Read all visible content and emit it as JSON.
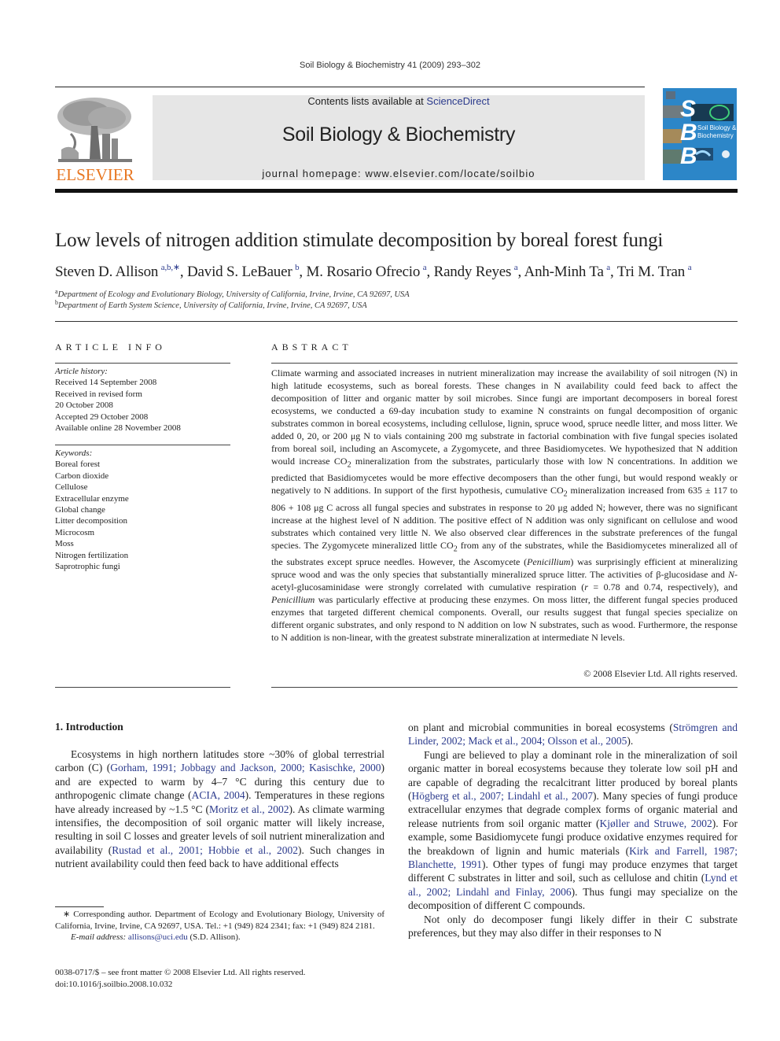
{
  "running_head": "Soil Biology & Biochemistry 41 (2009) 293–302",
  "publisher": {
    "name": "ELSEVIER",
    "color": "#e87722"
  },
  "banner": {
    "contents_prefix": "Contents lists available at ",
    "contents_link": "ScienceDirect",
    "journal_title": "Soil Biology & Biochemistry",
    "homepage": "journal homepage: www.elsevier.com/locate/soilbio"
  },
  "cover": {
    "letters": [
      "S",
      "B",
      "B"
    ],
    "caption_line1": "Soil Biology &",
    "caption_line2": "Biochemistry",
    "bg_color": "#2c86c8"
  },
  "article": {
    "title": "Low levels of nitrogen addition stimulate decomposition by boreal forest fungi",
    "authors": [
      {
        "name": "Steven D. Allison",
        "sup": "a,b,∗",
        "sep": ", "
      },
      {
        "name": "David S. LeBauer",
        "sup": "b",
        "sep": ", "
      },
      {
        "name": "M. Rosario Ofrecio",
        "sup": "a",
        "sep": ", "
      },
      {
        "name": "Randy Reyes",
        "sup": "a",
        "sep": ", "
      },
      {
        "name": "Anh-Minh Ta",
        "sup": "a",
        "sep": ", "
      },
      {
        "name": "Tri M. Tran",
        "sup": "a",
        "sep": ""
      }
    ],
    "affiliations": [
      {
        "mark": "a",
        "text": "Department of Ecology and Evolutionary Biology, University of California, Irvine, Irvine, CA 92697, USA"
      },
      {
        "mark": "b",
        "text": "Department of Earth System Science, University of California, Irvine, Irvine, CA 92697, USA"
      }
    ]
  },
  "article_info": {
    "heading": "ARTICLE INFO",
    "history_label": "Article history:",
    "history": [
      "Received 14 September 2008",
      "Received in revised form",
      "20 October 2008",
      "Accepted 29 October 2008",
      "Available online 28 November 2008"
    ],
    "keywords_label": "Keywords:",
    "keywords": [
      "Boreal forest",
      "Carbon dioxide",
      "Cellulose",
      "Extracellular enzyme",
      "Global change",
      "Litter decomposition",
      "Microcosm",
      "Moss",
      "Nitrogen fertilization",
      "Saprotrophic fungi"
    ]
  },
  "abstract": {
    "heading": "ABSTRACT",
    "p1": "Climate warming and associated increases in nutrient mineralization may increase the availability of soil nitrogen (N) in high latitude ecosystems, such as boreal forests. These changes in N availability could feed back to affect the decomposition of litter and organic matter by soil microbes. Since fungi are important decomposers in boreal forest ecosystems, we conducted a 69-day incubation study to examine N constraints on fungal decomposition of organic substrates common in boreal ecosystems, including cellulose, lignin, spruce wood, spruce needle litter, and moss litter. We added 0, 20, or 200 μg N to vials containing 200 mg substrate in factorial combination with five fungal species isolated from boreal soil, including an Ascomycete, a Zygomycete, and three Basidiomycetes. We hypothesized that N addition would increase CO",
    "p2": " mineralization from the substrates, particularly those with low N concentrations. In addition we predicted that Basidiomycetes would be more effective decomposers than the other fungi, but would respond weakly or negatively to N additions. In support of the first hypothesis, cumulative CO",
    "p3": " mineralization increased from 635 ± 117 to 806 + 108 μg C across all fungal species and substrates in response to 20 μg added N; however, there was no significant increase at the highest level of N addition. The positive effect of N addition was only significant on cellulose and wood substrates which contained very little N. We also observed clear differences in the substrate preferences of the fungal species. The Zygomycete mineralized little CO",
    "p4": " from any of the substrates, while the Basidiomycetes mineralized all of the substrates except spruce needles. However, the Ascomycete (",
    "genus": "Penicillium",
    "p5": ") was surprisingly efficient at mineralizing spruce wood and was the only species that substantially mineralized spruce litter. The activities of β-glucosidase and ",
    "n_prefix": "N",
    "p6": "-acetyl-glucosaminidase were strongly correlated with cumulative respiration (",
    "r_symbol": "r",
    "p7": " = 0.78 and 0.74, respectively), and ",
    "p8": " was particularly effective at producing these enzymes. On moss litter, the different fungal species produced enzymes that targeted different chemical components. Overall, our results suggest that fungal species specialize on different organic substrates, and only respond to N addition on low N substrates, such as wood. Furthermore, the response to N addition is non-linear, with the greatest substrate mineralization at intermediate N levels.",
    "sub2": "2",
    "copyright": "© 2008 Elsevier Ltd. All rights reserved."
  },
  "introduction": {
    "heading": "1.  Introduction",
    "left": {
      "p1_a": "Ecosystems in high northern latitudes store ~30% of global terrestrial carbon (C) (",
      "cite1": "Gorham, 1991; Jobbagy and Jackson, 2000; Kasischke, 2000",
      "p1_b": ") and are expected to warm by 4–7 °C during this century due to anthropogenic climate change (",
      "cite2": "ACIA, 2004",
      "p1_c": "). Temperatures in these regions have already increased by ~1.5 °C (",
      "cite3": "Moritz et al., 2002",
      "p1_d": "). As climate warming intensifies, the decomposition of soil organic matter will likely increase, resulting in soil C losses and greater levels of soil nutrient mineralization and availability (",
      "cite4": "Rustad et al., 2001; Hobbie et al., 2002",
      "p1_e": "). Such changes in nutrient availability could then feed back to have additional effects"
    },
    "right": {
      "p1_a": "on plant and microbial communities in boreal ecosystems (",
      "cite1": "Strömgren and Linder, 2002; Mack et al., 2004; Olsson et al., 2005",
      "p1_b": ").",
      "p2_a": "Fungi are believed to play a dominant role in the mineralization of soil organic matter in boreal ecosystems because they tolerate low soil pH and are capable of degrading the recalcitrant litter produced by boreal plants (",
      "cite2": "Högberg et al., 2007; Lindahl et al., 2007",
      "p2_b": "). Many species of fungi produce extracellular enzymes that degrade complex forms of organic material and release nutrients from soil organic matter (",
      "cite3": "Kjøller and Struwe, 2002",
      "p2_c": "). For example, some Basidiomycete fungi produce oxidative enzymes required for the breakdown of lignin and humic materials (",
      "cite4": "Kirk and Farrell, 1987; Blanchette, 1991",
      "p2_d": "). Other types of fungi may produce enzymes that target different C substrates in litter and soil, such as cellulose and chitin (",
      "cite5": "Lynd et al., 2002; Lindahl and Finlay, 2006",
      "p2_e": "). Thus fungi may specialize on the decomposition of different C compounds.",
      "p3": "Not only do decomposer fungi likely differ in their C substrate preferences, but they may also differ in their responses to N"
    }
  },
  "footnote": {
    "star": "∗",
    "corresponding": " Corresponding author. Department of Ecology and Evolutionary Biology, University of California, Irvine, Irvine, CA 92697, USA. Tel.: +1 (949) 824 2341; fax: +1 (949) 824 2181.",
    "email_label": "E-mail address:",
    "email": "allisons@uci.edu",
    "email_suffix": " (S.D. Allison)."
  },
  "issn": {
    "line1": "0038-0717/$ – see front matter © 2008 Elsevier Ltd. All rights reserved.",
    "line2": "doi:10.1016/j.soilbio.2008.10.032"
  }
}
